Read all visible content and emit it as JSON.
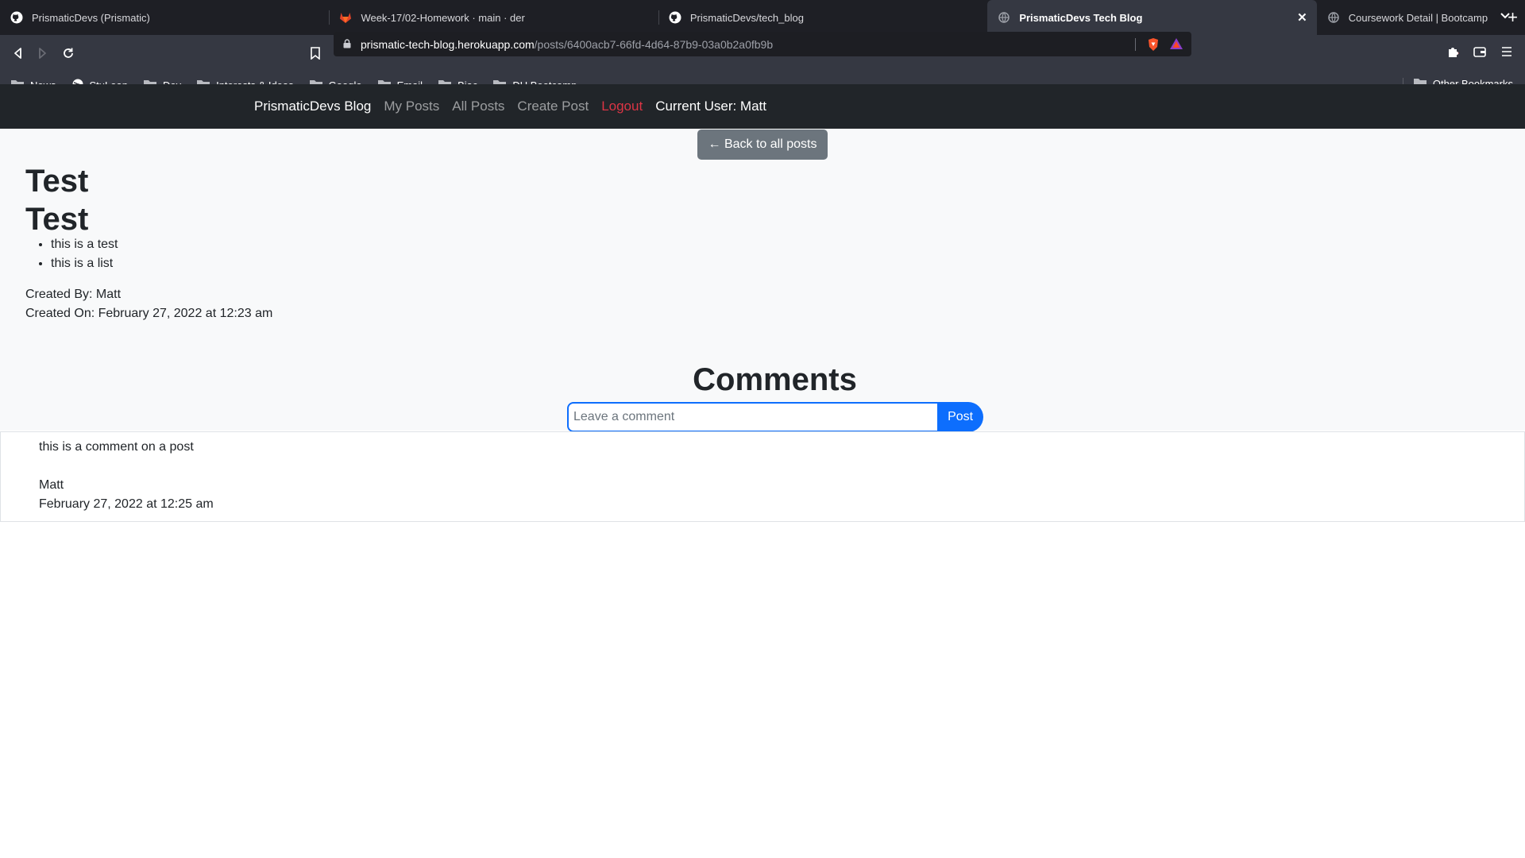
{
  "browser": {
    "tabs": [
      {
        "title": "PrismaticDevs (Prismatic)",
        "icon": "github-icon",
        "active": false
      },
      {
        "title": "Week-17/02-Homework · main · der",
        "icon": "gitlab-icon",
        "active": false
      },
      {
        "title": "PrismaticDevs/tech_blog",
        "icon": "github-icon",
        "active": false
      },
      {
        "title": "PrismaticDevs Tech Blog",
        "icon": "globe-icon",
        "active": true
      },
      {
        "title": "Coursework Detail | Bootcamp Spot",
        "icon": "globe-icon",
        "active": false
      }
    ],
    "url": {
      "domain": "prismatic-tech-blog.herokuapp.com",
      "path": "/posts/6400acb7-66fd-4d64-87b9-03a0b2a0fb9b"
    },
    "bookmarks": [
      "News",
      "StuLoan",
      "Dev",
      "Interests & Ideas",
      "Google",
      "Email",
      "Biac",
      "DU Bootcamp"
    ],
    "other_bookmarks": "Other Bookmarks"
  },
  "site_nav": {
    "brand": "PrismaticDevs Blog",
    "my_posts": "My Posts",
    "all_posts": "All Posts",
    "create_post": "Create Post",
    "logout": "Logout",
    "current_user": "Current User: Matt"
  },
  "post": {
    "back_label": "← Back to all posts",
    "title": "Test",
    "subtitle": "Test",
    "list_items": [
      "this is a test",
      "this is a list"
    ],
    "created_by": "Created By: Matt",
    "created_on": "Created On: February 27, 2022 at 12:23 am"
  },
  "comments": {
    "heading": "Comments",
    "placeholder": "Leave a comment",
    "post_label": "Post",
    "items": [
      {
        "text": "this is a comment on a post",
        "author": "Matt",
        "date": "February 27, 2022 at 12:25 am"
      }
    ]
  },
  "colors": {
    "primary": "#0d6efd",
    "secondary": "#6c757d",
    "danger": "#dc3545",
    "navbar": "#212529"
  }
}
